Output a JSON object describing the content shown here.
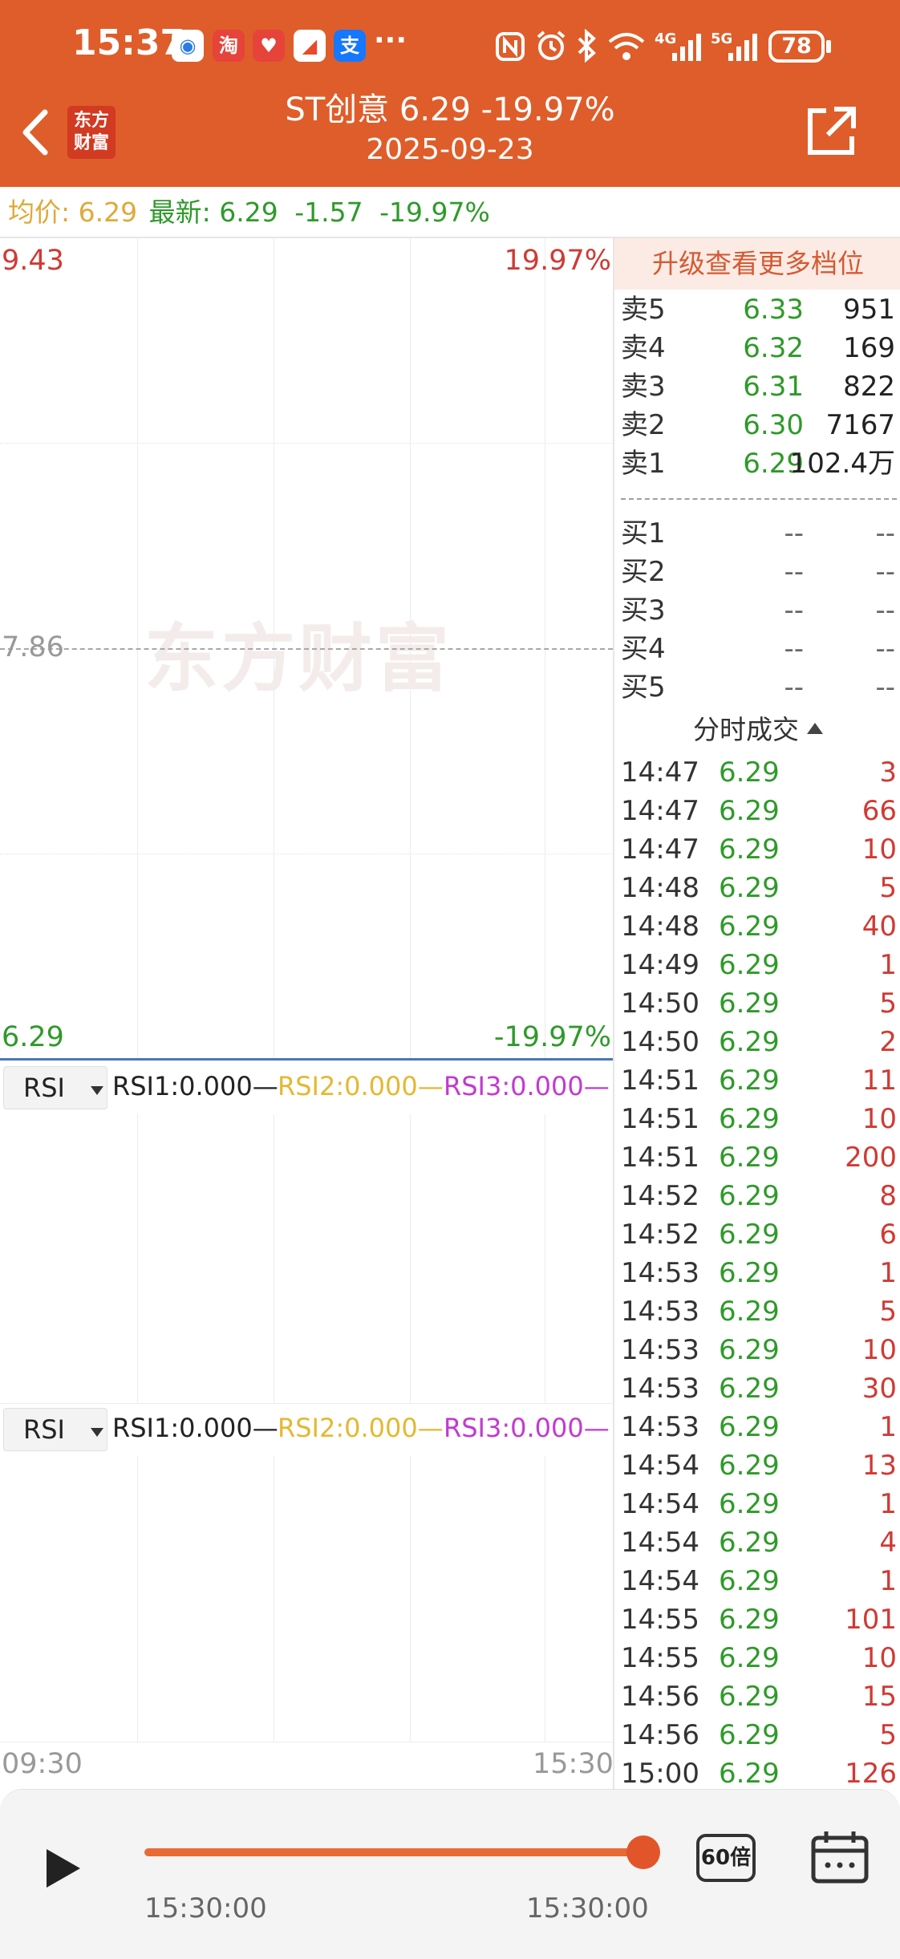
{
  "status_bar": {
    "time": "15:37",
    "more": "···",
    "signal_4g": "4G",
    "signal_5g": "5G",
    "battery": "78"
  },
  "header": {
    "logo_line1": "东方",
    "logo_line2": "财富",
    "title": "ST创意  6.29  -19.97%",
    "date": "2025-09-23"
  },
  "summary": {
    "avg_label": "均价:",
    "avg_value": "6.29",
    "latest_label": "最新:",
    "latest_value": "6.29",
    "change": "-1.57",
    "change_pct": "-19.97%"
  },
  "chart": {
    "price_high": "9.43",
    "pct_high": "19.97%",
    "price_mid": "7.86",
    "price_low": "6.29",
    "pct_low": "-19.97%",
    "watermark": "东方财富",
    "time_start": "09:30",
    "time_end": "15:30",
    "indicators": [
      {
        "select": "RSI",
        "rsi1": "RSI1:0.000—",
        "rsi2": "RSI2:0.000—",
        "rsi3": "RSI3:0.000—"
      },
      {
        "select": "RSI",
        "rsi1": "RSI1:0.000—",
        "rsi2": "RSI2:0.000—",
        "rsi3": "RSI3:0.000—"
      }
    ]
  },
  "panel": {
    "upgrade": "升级查看更多档位",
    "sell": [
      {
        "label": "卖5",
        "price": "6.33",
        "vol": "951"
      },
      {
        "label": "卖4",
        "price": "6.32",
        "vol": "169"
      },
      {
        "label": "卖3",
        "price": "6.31",
        "vol": "822"
      },
      {
        "label": "卖2",
        "price": "6.30",
        "vol": "7167"
      },
      {
        "label": "卖1",
        "price": "6.29",
        "vol": "102.4万"
      }
    ],
    "buy": [
      {
        "label": "买1",
        "price": "--",
        "vol": "--"
      },
      {
        "label": "买2",
        "price": "--",
        "vol": "--"
      },
      {
        "label": "买3",
        "price": "--",
        "vol": "--"
      },
      {
        "label": "买4",
        "price": "--",
        "vol": "--"
      },
      {
        "label": "买5",
        "price": "--",
        "vol": "--"
      }
    ],
    "ticks_header": "分时成交",
    "ticks": [
      {
        "time": "14:47",
        "price": "6.29",
        "vol": "3"
      },
      {
        "time": "14:47",
        "price": "6.29",
        "vol": "66"
      },
      {
        "time": "14:47",
        "price": "6.29",
        "vol": "10"
      },
      {
        "time": "14:48",
        "price": "6.29",
        "vol": "5"
      },
      {
        "time": "14:48",
        "price": "6.29",
        "vol": "40"
      },
      {
        "time": "14:49",
        "price": "6.29",
        "vol": "1"
      },
      {
        "time": "14:50",
        "price": "6.29",
        "vol": "5"
      },
      {
        "time": "14:50",
        "price": "6.29",
        "vol": "2"
      },
      {
        "time": "14:51",
        "price": "6.29",
        "vol": "11"
      },
      {
        "time": "14:51",
        "price": "6.29",
        "vol": "10"
      },
      {
        "time": "14:51",
        "price": "6.29",
        "vol": "200"
      },
      {
        "time": "14:52",
        "price": "6.29",
        "vol": "8"
      },
      {
        "time": "14:52",
        "price": "6.29",
        "vol": "6"
      },
      {
        "time": "14:53",
        "price": "6.29",
        "vol": "1"
      },
      {
        "time": "14:53",
        "price": "6.29",
        "vol": "5"
      },
      {
        "time": "14:53",
        "price": "6.29",
        "vol": "10"
      },
      {
        "time": "14:53",
        "price": "6.29",
        "vol": "30"
      },
      {
        "time": "14:53",
        "price": "6.29",
        "vol": "1"
      },
      {
        "time": "14:54",
        "price": "6.29",
        "vol": "13"
      },
      {
        "time": "14:54",
        "price": "6.29",
        "vol": "1"
      },
      {
        "time": "14:54",
        "price": "6.29",
        "vol": "4"
      },
      {
        "time": "14:54",
        "price": "6.29",
        "vol": "1"
      },
      {
        "time": "14:55",
        "price": "6.29",
        "vol": "101"
      },
      {
        "time": "14:55",
        "price": "6.29",
        "vol": "10"
      },
      {
        "time": "14:56",
        "price": "6.29",
        "vol": "15"
      },
      {
        "time": "14:56",
        "price": "6.29",
        "vol": "5"
      },
      {
        "time": "15:00",
        "price": "6.29",
        "vol": "126"
      }
    ]
  },
  "player": {
    "start_time": "15:30:00",
    "end_time": "15:30:00",
    "speed": "60倍",
    "progress": 1.0
  },
  "colors": {
    "brand": "#df5d2a",
    "up": "#d03a34",
    "down": "#2f9a2a",
    "avg": "#e0a93a",
    "rsi3": "#c23ad1"
  }
}
